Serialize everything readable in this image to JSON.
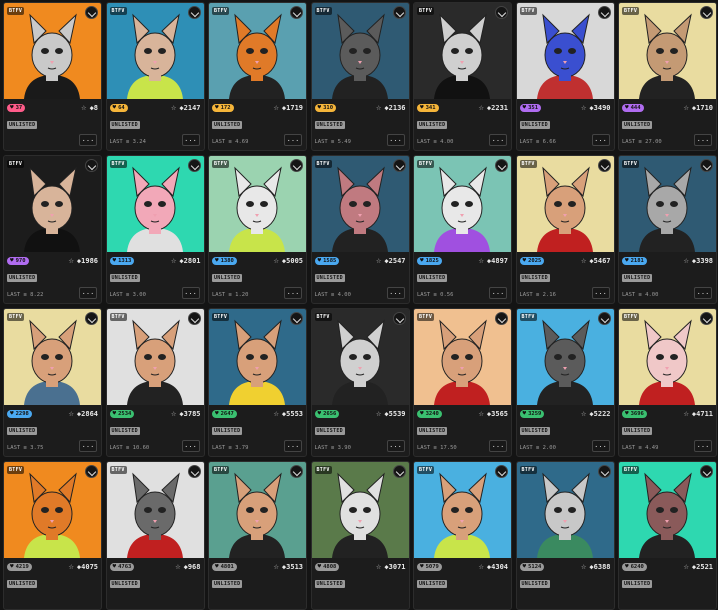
{
  "cards": [
    {
      "tag": "BTFV",
      "rank": "37",
      "rank_color": "#ff5c8a",
      "price": "8",
      "status": "UNLISTED",
      "last": "",
      "more": "...",
      "bg": "#f08a1f",
      "fur": "#c9c9c9",
      "accent": "#1a1a1a"
    },
    {
      "tag": "BTFV",
      "rank": "64",
      "rank_color": "#f5b53a",
      "price": "2147",
      "status": "UNLISTED",
      "last": "LAST ≡ 3.24",
      "more": "...",
      "bg": "#2e8fb6",
      "fur": "#d8b49a",
      "accent": "#c8e44a"
    },
    {
      "tag": "BTFV",
      "rank": "172",
      "rank_color": "#f5b53a",
      "price": "1719",
      "status": "UNLISTED",
      "last": "LAST ≡ 4.69",
      "more": "...",
      "bg": "#5aa0b0",
      "fur": "#e07a28",
      "accent": "#222"
    },
    {
      "tag": "BTFV",
      "rank": "310",
      "rank_color": "#f5b53a",
      "price": "2136",
      "status": "UNLISTED",
      "last": "LAST ≡ 5.49",
      "more": "...",
      "bg": "#2f5a73",
      "fur": "#5b5b5b",
      "accent": "#222"
    },
    {
      "tag": "BTFV",
      "rank": "341",
      "rank_color": "#f5b53a",
      "price": "2231",
      "status": "UNLISTED",
      "last": "LAST ≡ 4.00",
      "more": "...",
      "bg": "#2a2a2a",
      "fur": "#cfcfcf",
      "accent": "#111"
    },
    {
      "tag": "BTFV",
      "rank": "351",
      "rank_color": "#b06cf0",
      "price": "3490",
      "status": "UNLISTED",
      "last": "LAST ≡ 6.66",
      "more": "...",
      "bg": "#d8d8d8",
      "fur": "#3a4fd0",
      "accent": "#c03030"
    },
    {
      "tag": "BTFV",
      "rank": "444",
      "rank_color": "#b06cf0",
      "price": "1710",
      "status": "UNLISTED",
      "last": "LAST ≡ 27.00",
      "more": "...",
      "bg": "#e9dca0",
      "fur": "#c49a74",
      "accent": "#222"
    },
    {
      "tag": "BTFV",
      "rank": "970",
      "rank_color": "#b06cf0",
      "price": "1986",
      "status": "UNLISTED",
      "last": "LAST ≡ 8.22",
      "more": "...",
      "bg": "#1c1c1c",
      "fur": "#d8b49a",
      "accent": "#111"
    },
    {
      "tag": "BTFV",
      "rank": "1313",
      "rank_color": "#4aa8f0",
      "price": "2801",
      "status": "UNLISTED",
      "last": "LAST ≡ 3.00",
      "more": "...",
      "bg": "#2ed8b0",
      "fur": "#f2a8b8",
      "accent": "#e0e0e0"
    },
    {
      "tag": "BTFV",
      "rank": "1380",
      "rank_color": "#4aa8f0",
      "price": "5005",
      "status": "UNLISTED",
      "last": "LAST ≡ 1.20",
      "more": "...",
      "bg": "#9bd3b0",
      "fur": "#e8e8e8",
      "accent": "#c8e44a"
    },
    {
      "tag": "BTFV",
      "rank": "1585",
      "rank_color": "#4aa8f0",
      "price": "2547",
      "status": "UNLISTED",
      "last": "LAST ≡ 4.00",
      "more": "...",
      "bg": "#2f5a73",
      "fur": "#c07a80",
      "accent": "#222"
    },
    {
      "tag": "BTFV",
      "rank": "1825",
      "rank_color": "#4aa8f0",
      "price": "4897",
      "status": "UNLISTED",
      "last": "LAST ≡ 0.56",
      "more": "...",
      "bg": "#7bc4b4",
      "fur": "#e8e8e8",
      "accent": "#a050e0"
    },
    {
      "tag": "BTFV",
      "rank": "2025",
      "rank_color": "#4aa8f0",
      "price": "5467",
      "status": "UNLISTED",
      "last": "LAST ≡ 2.16",
      "more": "...",
      "bg": "#e9dca0",
      "fur": "#d8a07a",
      "accent": "#c02020"
    },
    {
      "tag": "BTFV",
      "rank": "2181",
      "rank_color": "#4aa8f0",
      "price": "3398",
      "status": "UNLISTED",
      "last": "LAST ≡ 4.00",
      "more": "...",
      "bg": "#2f5a73",
      "fur": "#a8a8a8",
      "accent": "#222"
    },
    {
      "tag": "BTFV",
      "rank": "2298",
      "rank_color": "#4aa8f0",
      "price": "2864",
      "status": "UNLISTED",
      "last": "LAST ≡ 3.75",
      "more": "...",
      "bg": "#e9dca0",
      "fur": "#d8a07a",
      "accent": "#4a7090"
    },
    {
      "tag": "BTFV",
      "rank": "2534",
      "rank_color": "#3ac070",
      "price": "3785",
      "status": "UNLISTED",
      "last": "LAST ≡ 10.60",
      "more": "...",
      "bg": "#e0e0e0",
      "fur": "#d8a07a",
      "accent": "#222"
    },
    {
      "tag": "BTFV",
      "rank": "2647",
      "rank_color": "#3ac070",
      "price": "5553",
      "status": "UNLISTED",
      "last": "LAST ≡ 3.79",
      "more": "...",
      "bg": "#2f6a8a",
      "fur": "#d8a07a",
      "accent": "#f0d030"
    },
    {
      "tag": "BTFV",
      "rank": "2656",
      "rank_color": "#3ac070",
      "price": "5539",
      "status": "UNLISTED",
      "last": "LAST ≡ 3.90",
      "more": "...",
      "bg": "#2a2a2a",
      "fur": "#d0d0d0",
      "accent": "#222"
    },
    {
      "tag": "BTFV",
      "rank": "3240",
      "rank_color": "#3ac070",
      "price": "3565",
      "status": "UNLISTED",
      "last": "LAST ≡ 17.50",
      "more": "...",
      "bg": "#f0c090",
      "fur": "#d8a07a",
      "accent": "#c02020"
    },
    {
      "tag": "BTFV",
      "rank": "3259",
      "rank_color": "#3ac070",
      "price": "5222",
      "status": "UNLISTED",
      "last": "LAST ≡ 2.00",
      "more": "...",
      "bg": "#4ab0e0",
      "fur": "#5b5b5b",
      "accent": "#222"
    },
    {
      "tag": "BTFV",
      "rank": "3696",
      "rank_color": "#3ac070",
      "price": "4711",
      "status": "UNLISTED",
      "last": "LAST ≡ 4.49",
      "more": "...",
      "bg": "#e9dca0",
      "fur": "#f0c8c8",
      "accent": "#c02020"
    },
    {
      "tag": "BTFV",
      "rank": "4219",
      "rank_color": "#9a9a9a",
      "price": "4075",
      "status": "UNLISTED",
      "last": "",
      "more": "",
      "bg": "#f08a1f",
      "fur": "#e07a28",
      "accent": "#c8e44a"
    },
    {
      "tag": "BTFV",
      "rank": "4763",
      "rank_color": "#9a9a9a",
      "price": "968",
      "status": "UNLISTED",
      "last": "",
      "more": "",
      "bg": "#e0e0e0",
      "fur": "#6a6a6a",
      "accent": "#c02020"
    },
    {
      "tag": "BTFV",
      "rank": "4801",
      "rank_color": "#9a9a9a",
      "price": "3513",
      "status": "UNLISTED",
      "last": "",
      "more": "",
      "bg": "#5aa090",
      "fur": "#d8a07a",
      "accent": "#222"
    },
    {
      "tag": "BTFV",
      "rank": "4808",
      "rank_color": "#9a9a9a",
      "price": "3071",
      "status": "UNLISTED",
      "last": "",
      "more": "",
      "bg": "#5a7a4a",
      "fur": "#e0e0e0",
      "accent": "#222"
    },
    {
      "tag": "BTFV",
      "rank": "5079",
      "rank_color": "#9a9a9a",
      "price": "4304",
      "status": "UNLISTED",
      "last": "",
      "more": "",
      "bg": "#4ab0e0",
      "fur": "#d8a07a",
      "accent": "#c8e44a"
    },
    {
      "tag": "BTFV",
      "rank": "5124",
      "rank_color": "#9a9a9a",
      "price": "6388",
      "status": "UNLISTED",
      "last": "",
      "more": "",
      "bg": "#2f6a8a",
      "fur": "#c8c8c8",
      "accent": "#3a8a60"
    },
    {
      "tag": "BTFV",
      "rank": "6240",
      "rank_color": "#9a9a9a",
      "price": "2521",
      "status": "UNLISTED",
      "last": "",
      "more": "",
      "bg": "#2ed8b0",
      "fur": "#8a5a5a",
      "accent": "#222"
    }
  ],
  "icons": {
    "favorite": "star-icon",
    "like": "heart-icon",
    "currency": "eth-icon",
    "brand": "collection-logo-icon"
  }
}
